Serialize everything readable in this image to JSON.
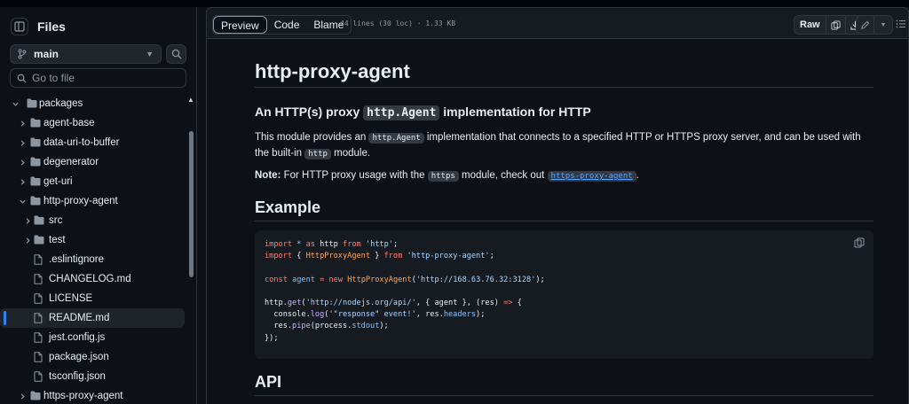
{
  "sidebar": {
    "title": "Files",
    "branch": "main",
    "goto_placeholder": "Go to file",
    "tree": [
      {
        "label": "packages",
        "type": "folder",
        "open": true,
        "depth": 0
      },
      {
        "label": "agent-base",
        "type": "folder",
        "open": false,
        "depth": 1
      },
      {
        "label": "data-uri-to-buffer",
        "type": "folder",
        "open": false,
        "depth": 1
      },
      {
        "label": "degenerator",
        "type": "folder",
        "open": false,
        "depth": 1
      },
      {
        "label": "get-uri",
        "type": "folder",
        "open": false,
        "depth": 1
      },
      {
        "label": "http-proxy-agent",
        "type": "folder",
        "open": true,
        "depth": 1
      },
      {
        "label": "src",
        "type": "folder",
        "open": false,
        "depth": 2
      },
      {
        "label": "test",
        "type": "folder",
        "open": false,
        "depth": 2
      },
      {
        "label": ".eslintignore",
        "type": "file",
        "depth": 2
      },
      {
        "label": "CHANGELOG.md",
        "type": "file",
        "depth": 2
      },
      {
        "label": "LICENSE",
        "type": "file",
        "depth": 2
      },
      {
        "label": "README.md",
        "type": "file",
        "depth": 2,
        "selected": true
      },
      {
        "label": "jest.config.js",
        "type": "file",
        "depth": 2
      },
      {
        "label": "package.json",
        "type": "file",
        "depth": 2
      },
      {
        "label": "tsconfig.json",
        "type": "file",
        "depth": 2
      },
      {
        "label": "https-proxy-agent",
        "type": "folder",
        "open": false,
        "depth": 1
      }
    ]
  },
  "toolbar": {
    "tabs": [
      "Preview",
      "Code",
      "Blame"
    ],
    "active_tab": "Preview",
    "file_info": "44 lines (30 loc) · 1.33 KB",
    "raw_label": "Raw"
  },
  "readme": {
    "title": "http-proxy-agent",
    "subtitle_pre": "An HTTP(s) proxy ",
    "subtitle_code": "http.Agent",
    "subtitle_post": " implementation for HTTP",
    "p1_pre": "This module provides an ",
    "p1_code1": "http.Agent",
    "p1_mid": " implementation that connects to a specified HTTP or HTTPS proxy server, and can be used with the built-in ",
    "p1_code2": "http",
    "p1_post": " module.",
    "note_label": "Note:",
    "note_pre": " For HTTP proxy usage with the ",
    "note_code": "https",
    "note_mid": " module, check out ",
    "note_link": "https-proxy-agent",
    "note_post": ".",
    "example_heading": "Example",
    "api_heading": "API"
  },
  "colors": {
    "background": "#0d1117",
    "accent": "#2f81f7",
    "link": "#58a6ff",
    "keyword": "#ff7b72",
    "string": "#a5d6ff"
  }
}
